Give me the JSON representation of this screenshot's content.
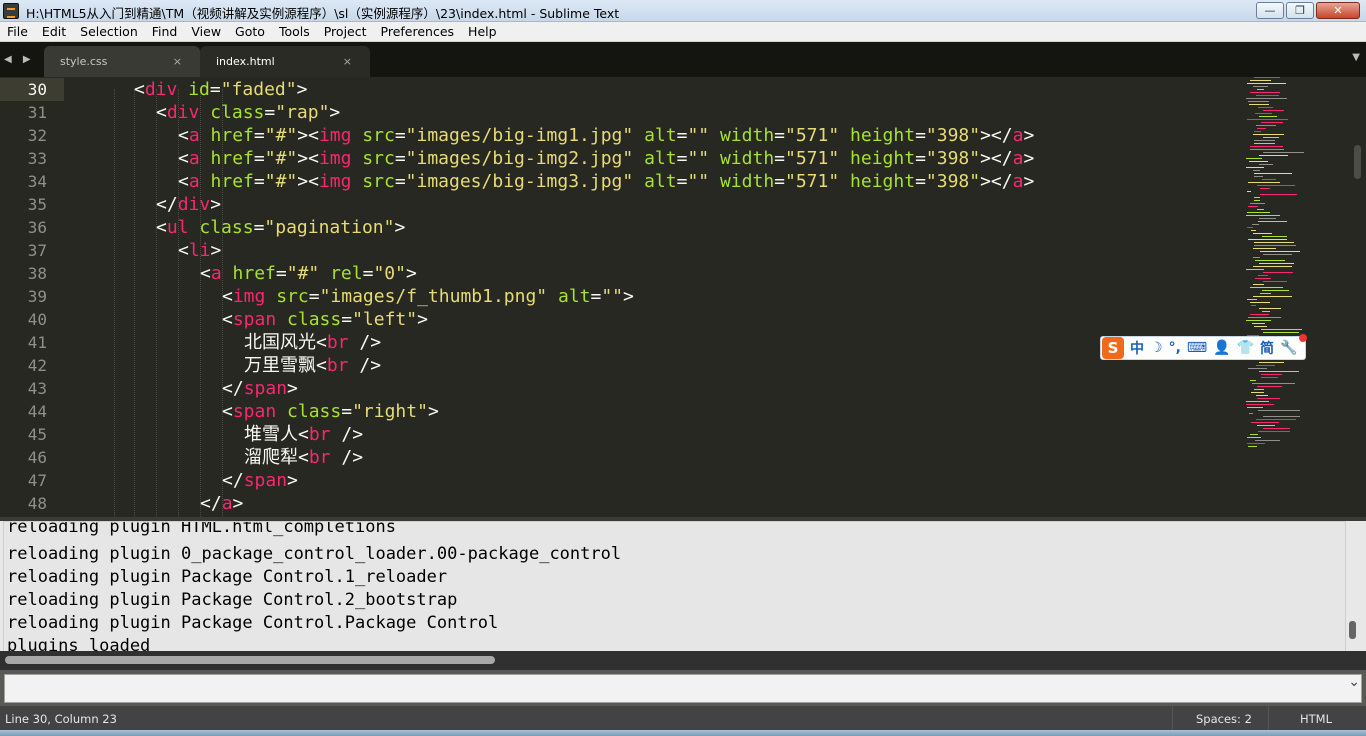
{
  "window": {
    "title": "H:\\HTML5从入门到精通\\TM（视频讲解及实例源程序）\\sl（实例源程序）\\23\\index.html - Sublime Text",
    "minimize": "—",
    "maximize": "❐",
    "close": "✕"
  },
  "menu": [
    "File",
    "Edit",
    "Selection",
    "Find",
    "View",
    "Goto",
    "Tools",
    "Project",
    "Preferences",
    "Help"
  ],
  "tabs": {
    "nav": "◀ ▶",
    "items": [
      {
        "label": "style.css",
        "close": "×"
      },
      {
        "label": "index.html",
        "close": "×"
      }
    ],
    "dropdown": "▼"
  },
  "editor": {
    "line_numbers": [
      "30",
      "31",
      "32",
      "33",
      "34",
      "35",
      "36",
      "37",
      "38",
      "39",
      "40",
      "41",
      "42",
      "43",
      "44",
      "45",
      "46",
      "47",
      "48"
    ],
    "current_line": "30",
    "lines": [
      [
        [
          "p",
          "<"
        ],
        [
          "tag",
          "div"
        ],
        [
          "p",
          " "
        ],
        [
          "attr",
          "id"
        ],
        [
          "p",
          "="
        ],
        [
          "str",
          "\"faded\""
        ],
        [
          "p",
          ">"
        ]
      ],
      [
        [
          "p",
          "<"
        ],
        [
          "tag",
          "div"
        ],
        [
          "p",
          " "
        ],
        [
          "attr",
          "class"
        ],
        [
          "p",
          "="
        ],
        [
          "str",
          "\"rap\""
        ],
        [
          "p",
          ">"
        ]
      ],
      [
        [
          "p",
          "<"
        ],
        [
          "tag",
          "a"
        ],
        [
          "p",
          " "
        ],
        [
          "attr",
          "href"
        ],
        [
          "p",
          "="
        ],
        [
          "str",
          "\"#\""
        ],
        [
          "p",
          ">"
        ],
        [
          "p",
          "<"
        ],
        [
          "tag",
          "img"
        ],
        [
          "p",
          " "
        ],
        [
          "attr",
          "src"
        ],
        [
          "p",
          "="
        ],
        [
          "str",
          "\"images/big-img1.jpg\""
        ],
        [
          "p",
          " "
        ],
        [
          "attr",
          "alt"
        ],
        [
          "p",
          "="
        ],
        [
          "str",
          "\"\""
        ],
        [
          "p",
          " "
        ],
        [
          "attr",
          "width"
        ],
        [
          "p",
          "="
        ],
        [
          "str",
          "\"571\""
        ],
        [
          "p",
          " "
        ],
        [
          "attr",
          "height"
        ],
        [
          "p",
          "="
        ],
        [
          "str",
          "\"398\""
        ],
        [
          "p",
          "></"
        ],
        [
          "tag",
          "a"
        ],
        [
          "p",
          ">"
        ]
      ],
      [
        [
          "p",
          "<"
        ],
        [
          "tag",
          "a"
        ],
        [
          "p",
          " "
        ],
        [
          "attr",
          "href"
        ],
        [
          "p",
          "="
        ],
        [
          "str",
          "\"#\""
        ],
        [
          "p",
          ">"
        ],
        [
          "p",
          "<"
        ],
        [
          "tag",
          "img"
        ],
        [
          "p",
          " "
        ],
        [
          "attr",
          "src"
        ],
        [
          "p",
          "="
        ],
        [
          "str",
          "\"images/big-img2.jpg\""
        ],
        [
          "p",
          " "
        ],
        [
          "attr",
          "alt"
        ],
        [
          "p",
          "="
        ],
        [
          "str",
          "\"\""
        ],
        [
          "p",
          " "
        ],
        [
          "attr",
          "width"
        ],
        [
          "p",
          "="
        ],
        [
          "str",
          "\"571\""
        ],
        [
          "p",
          " "
        ],
        [
          "attr",
          "height"
        ],
        [
          "p",
          "="
        ],
        [
          "str",
          "\"398\""
        ],
        [
          "p",
          "></"
        ],
        [
          "tag",
          "a"
        ],
        [
          "p",
          ">"
        ]
      ],
      [
        [
          "p",
          "<"
        ],
        [
          "tag",
          "a"
        ],
        [
          "p",
          " "
        ],
        [
          "attr",
          "href"
        ],
        [
          "p",
          "="
        ],
        [
          "str",
          "\"#\""
        ],
        [
          "p",
          ">"
        ],
        [
          "p",
          "<"
        ],
        [
          "tag",
          "img"
        ],
        [
          "p",
          " "
        ],
        [
          "attr",
          "src"
        ],
        [
          "p",
          "="
        ],
        [
          "str",
          "\"images/big-img3.jpg\""
        ],
        [
          "p",
          " "
        ],
        [
          "attr",
          "alt"
        ],
        [
          "p",
          "="
        ],
        [
          "str",
          "\"\""
        ],
        [
          "p",
          " "
        ],
        [
          "attr",
          "width"
        ],
        [
          "p",
          "="
        ],
        [
          "str",
          "\"571\""
        ],
        [
          "p",
          " "
        ],
        [
          "attr",
          "height"
        ],
        [
          "p",
          "="
        ],
        [
          "str",
          "\"398\""
        ],
        [
          "p",
          "></"
        ],
        [
          "tag",
          "a"
        ],
        [
          "p",
          ">"
        ]
      ],
      [
        [
          "p",
          "</"
        ],
        [
          "tag",
          "div"
        ],
        [
          "p",
          ">"
        ]
      ],
      [
        [
          "p",
          "<"
        ],
        [
          "tag",
          "ul"
        ],
        [
          "p",
          " "
        ],
        [
          "attr",
          "class"
        ],
        [
          "p",
          "="
        ],
        [
          "str",
          "\"pagination\""
        ],
        [
          "p",
          ">"
        ]
      ],
      [
        [
          "p",
          "<"
        ],
        [
          "tag",
          "li"
        ],
        [
          "p",
          ">"
        ]
      ],
      [
        [
          "p",
          "<"
        ],
        [
          "tag",
          "a"
        ],
        [
          "p",
          " "
        ],
        [
          "attr",
          "href"
        ],
        [
          "p",
          "="
        ],
        [
          "str",
          "\"#\""
        ],
        [
          "p",
          " "
        ],
        [
          "attr",
          "rel"
        ],
        [
          "p",
          "="
        ],
        [
          "str",
          "\"0\""
        ],
        [
          "p",
          ">"
        ]
      ],
      [
        [
          "p",
          "<"
        ],
        [
          "tag",
          "img"
        ],
        [
          "p",
          " "
        ],
        [
          "attr",
          "src"
        ],
        [
          "p",
          "="
        ],
        [
          "str",
          "\"images/f_thumb1.png\""
        ],
        [
          "p",
          " "
        ],
        [
          "attr",
          "alt"
        ],
        [
          "p",
          "="
        ],
        [
          "str",
          "\"\""
        ],
        [
          "p",
          ">"
        ]
      ],
      [
        [
          "p",
          "<"
        ],
        [
          "tag",
          "span"
        ],
        [
          "p",
          " "
        ],
        [
          "attr",
          "class"
        ],
        [
          "p",
          "="
        ],
        [
          "str",
          "\"left\""
        ],
        [
          "p",
          ">"
        ]
      ],
      [
        [
          "p",
          "北国风光<"
        ],
        [
          "tag",
          "br"
        ],
        [
          "p",
          " />"
        ]
      ],
      [
        [
          "p",
          "万里雪飘<"
        ],
        [
          "tag",
          "br"
        ],
        [
          "p",
          " />"
        ]
      ],
      [
        [
          "p",
          "</"
        ],
        [
          "tag",
          "span"
        ],
        [
          "p",
          ">"
        ]
      ],
      [
        [
          "p",
          "<"
        ],
        [
          "tag",
          "span"
        ],
        [
          "p",
          " "
        ],
        [
          "attr",
          "class"
        ],
        [
          "p",
          "="
        ],
        [
          "str",
          "\"right\""
        ],
        [
          "p",
          ">"
        ]
      ],
      [
        [
          "p",
          "堆雪人<"
        ],
        [
          "tag",
          "br"
        ],
        [
          "p",
          " />"
        ]
      ],
      [
        [
          "p",
          "溜爬犁<"
        ],
        [
          "tag",
          "br"
        ],
        [
          "p",
          " />"
        ]
      ],
      [
        [
          "p",
          "</"
        ],
        [
          "tag",
          "span"
        ],
        [
          "p",
          ">"
        ]
      ],
      [
        [
          "p",
          "</"
        ],
        [
          "tag",
          "a"
        ],
        [
          "p",
          ">"
        ]
      ]
    ]
  },
  "ime_toolbar": {
    "logo": "S",
    "items": [
      "中",
      "☽",
      "°,",
      "⌨",
      "👤",
      "👕",
      "简",
      "🔧"
    ]
  },
  "console": {
    "lines": [
      "reloading plugin HTML.html_completions",
      "reloading plugin 0_package_control_loader.00-package_control",
      "reloading plugin Package Control.1_reloader",
      "reloading plugin Package Control.2_bootstrap",
      "reloading plugin Package Control.Package Control",
      "plugins loaded"
    ]
  },
  "input": {
    "value": "",
    "chevron": "⌄"
  },
  "status": {
    "position": "Line 30, Column 23",
    "spaces": "Spaces: 2",
    "syntax": "HTML"
  }
}
